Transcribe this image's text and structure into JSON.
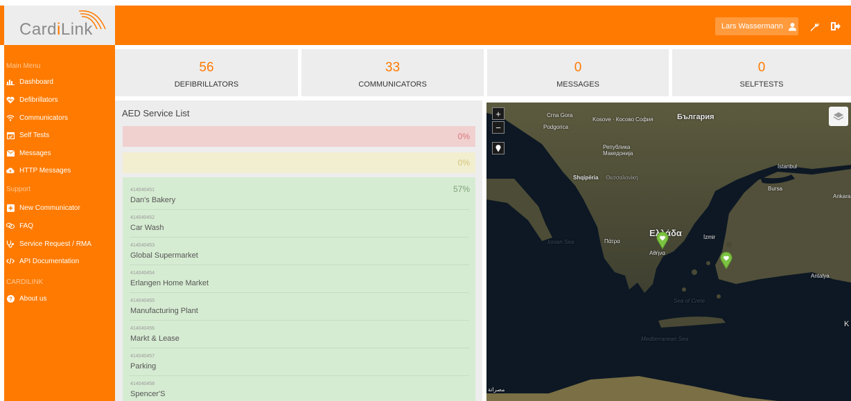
{
  "brand": {
    "logo_prefix": "Card",
    "logo_accent": "i",
    "logo_suffix": "Link"
  },
  "header": {
    "user_name": "Lars Wassermann"
  },
  "sidebar": {
    "main_menu_heading": "Main Menu",
    "main_items": [
      {
        "label": "Dashboard",
        "icon": "bar-chart-icon"
      },
      {
        "label": "Defibrillators",
        "icon": "heart-pulse-icon"
      },
      {
        "label": "Communicators",
        "icon": "wifi-icon"
      },
      {
        "label": "Self Tests",
        "icon": "calendar-check-icon"
      },
      {
        "label": "Messages",
        "icon": "envelope-icon"
      },
      {
        "label": "HTTP Messages",
        "icon": "cloud-upload-icon"
      }
    ],
    "support_heading": "Support",
    "support_items": [
      {
        "label": "New Communicator",
        "icon": "plus-square-icon"
      },
      {
        "label": "FAQ",
        "icon": "chat-icon"
      },
      {
        "label": "Service Request / RMA",
        "icon": "stethoscope-icon"
      },
      {
        "label": "API Documentation",
        "icon": "code-icon"
      }
    ],
    "cardilink_heading": "CARDILINK",
    "cardilink_items": [
      {
        "label": "About us",
        "icon": "question-circle-icon"
      }
    ]
  },
  "stats": [
    {
      "value": "56",
      "label": "DEFIBRILLATORS"
    },
    {
      "value": "33",
      "label": "COMMUNICATORS"
    },
    {
      "value": "0",
      "label": "MESSAGES"
    },
    {
      "value": "0",
      "label": "SELFTESTS"
    }
  ],
  "service_list": {
    "title": "AED Service List",
    "red_pct": "0%",
    "yellow_pct": "0%",
    "green_pct": "57%",
    "items": [
      {
        "id": "414040451",
        "name": "Dan's Bakery"
      },
      {
        "id": "414040452",
        "name": "Car Wash"
      },
      {
        "id": "414040453",
        "name": "Global Supermarket"
      },
      {
        "id": "414040454",
        "name": "Erlangen Home Market"
      },
      {
        "id": "414040455",
        "name": "Manufacturing Plant"
      },
      {
        "id": "414040456",
        "name": "Markt & Lease"
      },
      {
        "id": "414040457",
        "name": "Parking"
      },
      {
        "id": "414040458",
        "name": "Spencer'S"
      }
    ]
  },
  "map": {
    "zoom_in": "+",
    "zoom_out": "−",
    "labels": {
      "crna_gora": "Crna Gora",
      "podgorica": "Podgorica",
      "kosovo": "Kosove · Косово",
      "sofia": "София",
      "bulgaria": "България",
      "macedonia": "Република Македонија",
      "shqiperia": "Shqipëria",
      "thessaloniki": "Θεσσαλονίκη",
      "istanbul": "İstanbul",
      "bursa": "Bursa",
      "ankara": "Ankara",
      "greece": "Ελλάδα",
      "izmir": "İzmir",
      "patra": "Πάτρα",
      "athens": "Αθήνα",
      "ionian": "Ionian Sea",
      "antalya": "Antalya",
      "sea_of_crete": "Sea of Crete",
      "mediterranean": "Mediterranean Sea",
      "misrata": "مصراتة",
      "edge_k": "K"
    }
  },
  "colors": {
    "brand_orange": "#ff7a00",
    "red_bar": "#f1d0d0",
    "yellow_bar": "#f2eed0",
    "green_box": "#d6ecd2",
    "marker_green": "#7cc242"
  }
}
